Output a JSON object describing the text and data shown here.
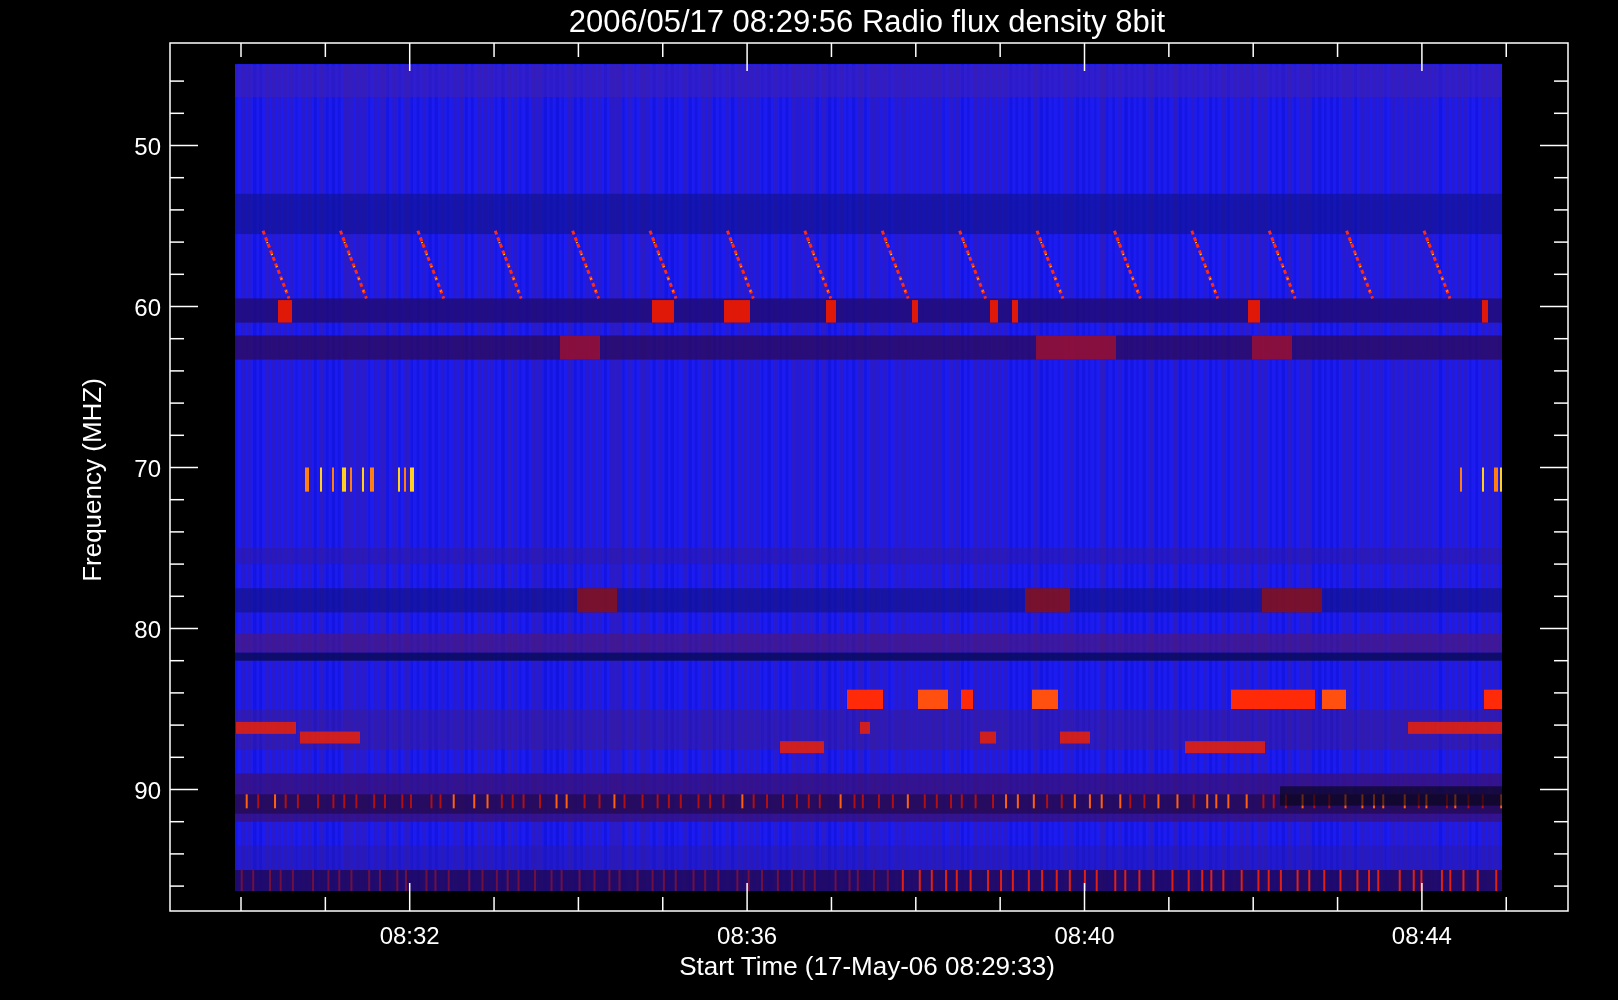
{
  "title": "2006/05/17 08:29:56 Radio flux density 8bit",
  "y_axis": {
    "label": "Frequency (MHZ)",
    "tick_labels": [
      "50",
      "60",
      "70",
      "80",
      "90"
    ]
  },
  "x_axis": {
    "label": "Start Time (17-May-06 08:29:33)",
    "tick_labels": [
      "08:32",
      "08:36",
      "08:40",
      "08:44"
    ]
  }
}
